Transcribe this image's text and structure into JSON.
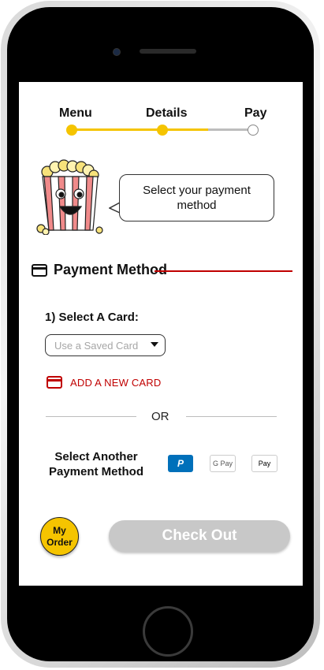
{
  "progress": {
    "steps": [
      {
        "label": "Menu",
        "state": "done"
      },
      {
        "label": "Details",
        "state": "done"
      },
      {
        "label": "Pay",
        "state": "current"
      }
    ],
    "fill_fraction": 0.75,
    "accent_color": "#f5c400"
  },
  "mascot": {
    "icon": "popcorn-mascot-icon"
  },
  "bubble": {
    "text": "Select your payment method"
  },
  "section": {
    "title": "Payment Method",
    "icon": "credit-card-icon",
    "rule_color": "#c00000"
  },
  "select_card": {
    "label": "1) Select A Card:",
    "placeholder": "Use a Saved Card"
  },
  "add_card": {
    "label": "ADD A NEW CARD",
    "color": "#c00000",
    "icon": "credit-card-icon"
  },
  "divider": {
    "text": "OR"
  },
  "other_methods": {
    "label": "Select Another Payment Method",
    "options": [
      {
        "name": "paypal",
        "label": "P"
      },
      {
        "name": "google-pay",
        "label": "G Pay"
      },
      {
        "name": "apple-pay",
        "label": " Pay"
      }
    ]
  },
  "footer": {
    "my_order_label": "My Order",
    "checkout_label": "Check Out",
    "checkout_color": "#c8c8c8"
  }
}
